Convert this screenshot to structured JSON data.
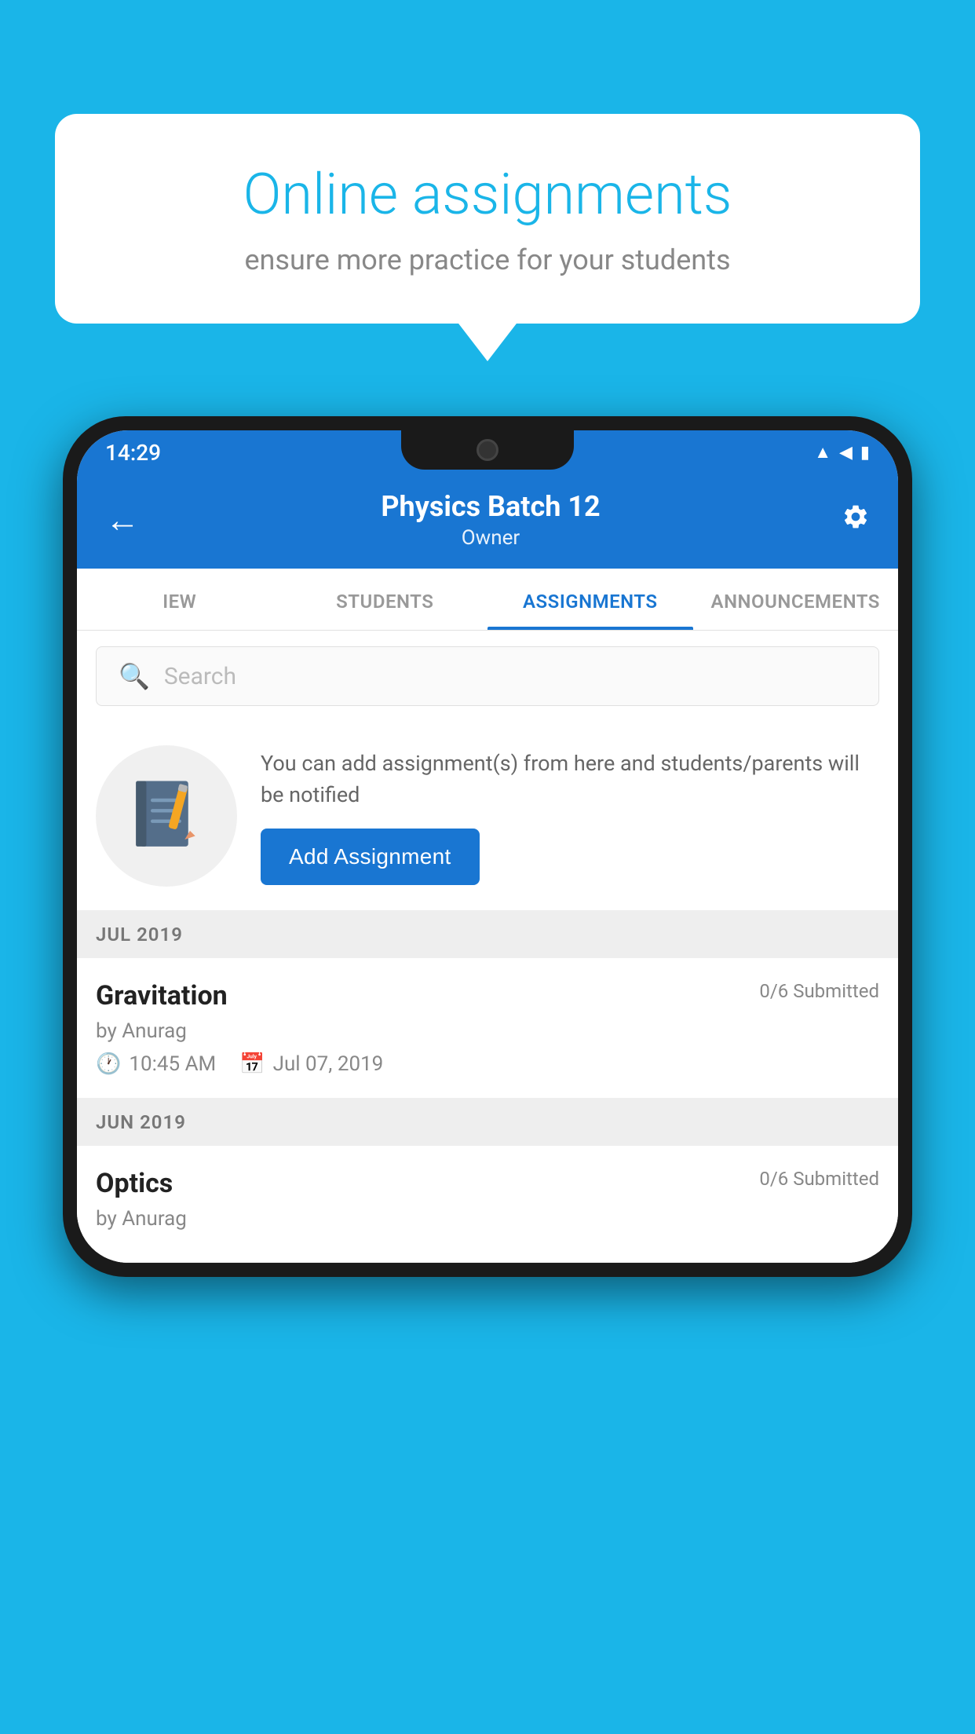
{
  "background_color": "#1ab5e8",
  "speech_bubble": {
    "title": "Online assignments",
    "subtitle": "ensure more practice for your students"
  },
  "status_bar": {
    "time": "14:29",
    "icons": [
      "wifi",
      "signal",
      "battery"
    ]
  },
  "header": {
    "title": "Physics Batch 12",
    "subtitle": "Owner",
    "back_label": "←",
    "settings_label": "⚙"
  },
  "tabs": [
    {
      "label": "IEW",
      "active": false
    },
    {
      "label": "STUDENTS",
      "active": false
    },
    {
      "label": "ASSIGNMENTS",
      "active": true
    },
    {
      "label": "ANNOUNCEMENTS",
      "active": false
    }
  ],
  "search": {
    "placeholder": "Search"
  },
  "promo": {
    "text": "You can add assignment(s) from here and students/parents will be notified",
    "button_label": "Add Assignment"
  },
  "sections": [
    {
      "label": "JUL 2019",
      "assignments": [
        {
          "name": "Gravitation",
          "submitted": "0/6 Submitted",
          "author": "by Anurag",
          "time": "10:45 AM",
          "date": "Jul 07, 2019"
        }
      ]
    },
    {
      "label": "JUN 2019",
      "assignments": [
        {
          "name": "Optics",
          "submitted": "0/6 Submitted",
          "author": "by Anurag",
          "time": "",
          "date": ""
        }
      ]
    }
  ]
}
